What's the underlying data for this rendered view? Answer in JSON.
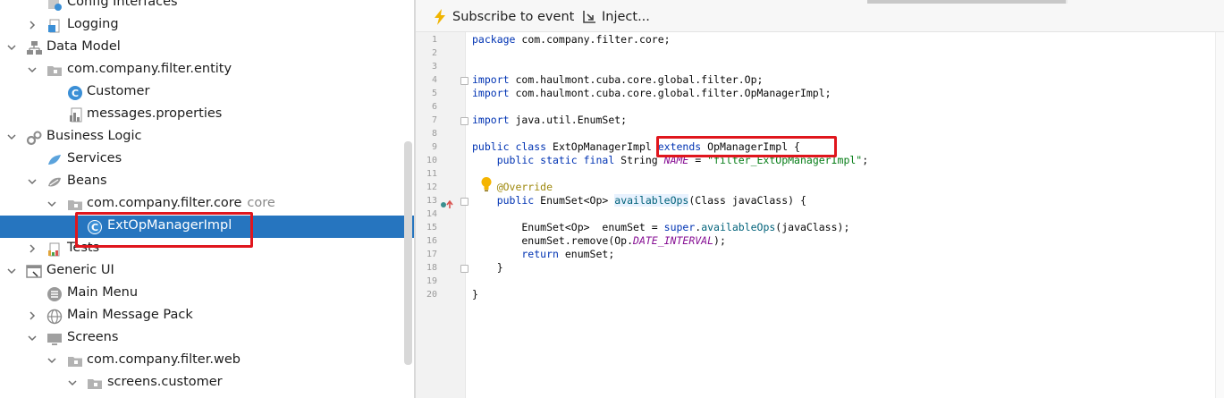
{
  "tree": {
    "items": [
      {
        "label": "Config Interfaces",
        "hint": "",
        "icon": "config-interfaces-icon",
        "arrow": "",
        "indent": 1
      },
      {
        "label": "Logging",
        "hint": "",
        "icon": "logging-icon",
        "arrow": "right",
        "indent": 1
      },
      {
        "label": "Data Model",
        "hint": "",
        "icon": "data-model-icon",
        "arrow": "down",
        "indent": 0
      },
      {
        "label": "com.company.filter.entity",
        "hint": "",
        "icon": "package-folder-icon",
        "arrow": "down",
        "indent": 1
      },
      {
        "label": "Customer",
        "hint": "",
        "icon": "class-icon",
        "arrow": "",
        "indent": 2
      },
      {
        "label": "messages.properties",
        "hint": "",
        "icon": "properties-file-icon",
        "arrow": "",
        "indent": 2
      },
      {
        "label": "Business Logic",
        "hint": "",
        "icon": "gears-icon",
        "arrow": "down",
        "indent": 0
      },
      {
        "label": "Services",
        "hint": "",
        "icon": "services-icon",
        "arrow": "",
        "indent": 1
      },
      {
        "label": "Beans",
        "hint": "",
        "icon": "beans-icon",
        "arrow": "down",
        "indent": 1
      },
      {
        "label": "com.company.filter.core",
        "hint": "core",
        "icon": "package-folder-icon",
        "arrow": "down",
        "indent": 2
      },
      {
        "label": "ExtOpManagerImpl",
        "hint": "",
        "icon": "class-icon",
        "arrow": "",
        "indent": 3,
        "selected": true
      },
      {
        "label": "Tests",
        "hint": "",
        "icon": "tests-icon",
        "arrow": "right",
        "indent": 1
      },
      {
        "label": "Generic UI",
        "hint": "",
        "icon": "generic-ui-icon",
        "arrow": "down",
        "indent": 0
      },
      {
        "label": "Main Menu",
        "hint": "",
        "icon": "menu-icon",
        "arrow": "",
        "indent": 1
      },
      {
        "label": "Main Message Pack",
        "hint": "",
        "icon": "globe-icon",
        "arrow": "right",
        "indent": 1
      },
      {
        "label": "Screens",
        "hint": "",
        "icon": "screens-icon",
        "arrow": "down",
        "indent": 1
      },
      {
        "label": "com.company.filter.web",
        "hint": "",
        "icon": "package-folder-icon",
        "arrow": "down",
        "indent": 2
      },
      {
        "label": "screens.customer",
        "hint": "",
        "icon": "package-folder-icon",
        "arrow": "down",
        "indent": 3
      }
    ]
  },
  "toolbar": {
    "subscribe_label": "Subscribe to event",
    "inject_label": "Inject..."
  },
  "editor": {
    "line_numbers": [
      "1",
      "2",
      "3",
      "4",
      "5",
      "6",
      "7",
      "8",
      "9",
      "10",
      "11",
      "12",
      "13",
      "14",
      "15",
      "16",
      "17",
      "18",
      "19",
      "20"
    ],
    "lines": {
      "l1": {
        "kw": "package",
        "rest": " com.company.filter.core;"
      },
      "l4": {
        "kw": "import",
        "rest": " com.haulmont.cuba.core.global.filter.Op;"
      },
      "l5": {
        "kw": "import",
        "rest": " com.haulmont.cuba.core.global.filter.OpManagerImpl;"
      },
      "l7": {
        "kw": "import",
        "rest": " java.util.EnumSet;"
      },
      "l9": {
        "kw1": "public class",
        "name": " ExtOpManagerImpl ",
        "kw2": "extends",
        "rest": " OpManagerImpl {"
      },
      "l10": {
        "kw": "    public static final",
        "type": " String ",
        "const": "NAME",
        "eq": " = ",
        "str": "\"filter_ExtOpManagerImpl\"",
        "end": ";"
      },
      "l12": {
        "ann": "    @Override"
      },
      "l13": {
        "kw": "    public",
        "type": " EnumSet<Op> ",
        "meth": "availableOps",
        "rest": "(Class javaClass) {"
      },
      "l15": {
        "pre": "        EnumSet<Op>  enumSet = ",
        "kw": "super",
        "dot": ".",
        "call": "availableOps",
        "rest": "(javaClass);"
      },
      "l16": {
        "pre": "        enumSet.remove(Op.",
        "const": "DATE_INTERVAL",
        "rest": ");"
      },
      "l17": {
        "kw": "        return",
        "rest": " enumSet;"
      },
      "l18": {
        "rest": "    }"
      },
      "l20": {
        "rest": "}"
      }
    }
  },
  "colors": {
    "selection": "#2675bf",
    "highlight_box": "#e0161d",
    "keyword": "#0033b3",
    "annotation": "#9e880d",
    "string": "#067d17",
    "constant": "#871094"
  }
}
